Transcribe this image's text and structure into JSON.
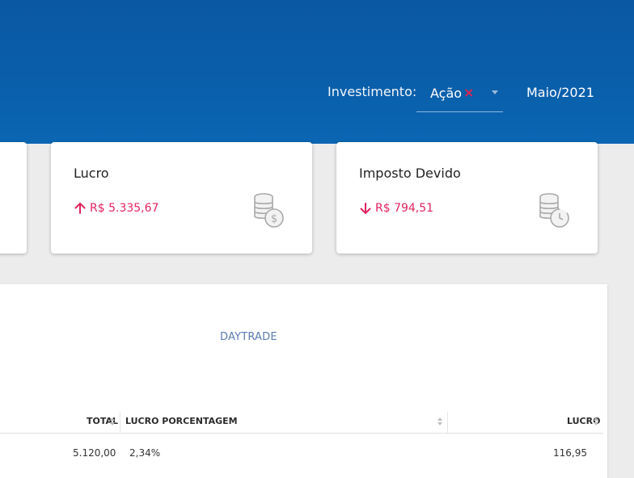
{
  "header": {
    "investment_label": "Investimento:",
    "investment_value": "Ação",
    "month": "Maio/2021"
  },
  "cards": {
    "lucro": {
      "title": "Lucro",
      "value": "R$ 5.335,67",
      "trend": "up",
      "icon": "coins-dollar-icon"
    },
    "imposto": {
      "title": "Imposto Devido",
      "value": "R$ 794,51",
      "trend": "down",
      "icon": "coins-clock-icon"
    }
  },
  "panel": {
    "title": "DAYTRADE",
    "columns": [
      "TOTAL",
      "LUCRO PORCENTAGEM",
      "LUCRO"
    ],
    "rows": [
      {
        "total": "5.120,00",
        "pct": "2,34%",
        "lucro": "116,95"
      }
    ]
  },
  "colors": {
    "header": "#0a5faa",
    "accent_pink": "#e0245e",
    "title_blue": "#5c7bb1"
  }
}
